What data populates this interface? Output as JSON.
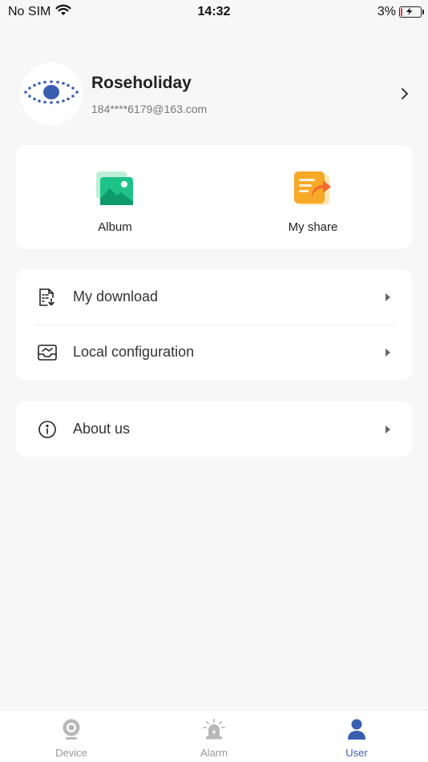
{
  "status_bar": {
    "carrier": "No SIM",
    "time": "14:32",
    "battery": "3%",
    "battery_level": 0.03
  },
  "profile": {
    "name": "Roseholiday",
    "email": "184****6179@163.com"
  },
  "quick_actions": [
    {
      "label": "Album",
      "icon": "album-icon"
    },
    {
      "label": "My share",
      "icon": "share-icon"
    }
  ],
  "menu": {
    "group1": [
      {
        "label": "My download",
        "icon": "download-list-icon"
      },
      {
        "label": "Local configuration",
        "icon": "inbox-icon"
      }
    ],
    "group2": [
      {
        "label": "About us",
        "icon": "info-icon"
      }
    ]
  },
  "tabs": [
    {
      "label": "Device",
      "icon": "camera-icon",
      "active": false
    },
    {
      "label": "Alarm",
      "icon": "alarm-icon",
      "active": false
    },
    {
      "label": "User",
      "icon": "user-icon",
      "active": true
    }
  ],
  "colors": {
    "accent": "#3a5fb0",
    "background": "#f7f7f7",
    "album_green": "#1fc38a",
    "share_orange": "#f7a928"
  }
}
